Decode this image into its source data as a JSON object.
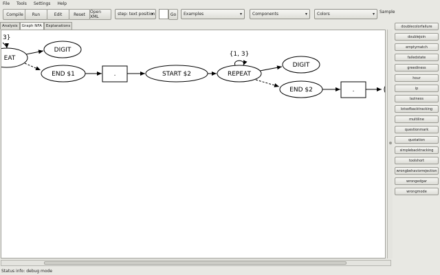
{
  "menu": [
    "File",
    "Tools",
    "Settings",
    "Help"
  ],
  "toolbar": {
    "compile": "Compile",
    "run": "Run",
    "edit": "Edit",
    "reset": "Reset",
    "open_xml": "Open XML",
    "position_field": "step: text position",
    "go": "Go",
    "examples": "Examples",
    "components": "Components",
    "colors": "Colors",
    "sample_label": "Sample"
  },
  "tabs": [
    "Analysis",
    "Graph NFA",
    "Explanations"
  ],
  "graph": {
    "nodes": {
      "repeat_left": "EAT",
      "repeat_left_range": "3}",
      "digit1": "DIGIT",
      "end1": "END $1",
      "dot1": ".",
      "start2": "START $2",
      "repeat2": "REPEAT",
      "repeat2_range": "{1, 3}",
      "digit2": "DIGIT",
      "end2": "END $2",
      "dot2": "."
    }
  },
  "samples": [
    "doublecolorfailure",
    "doublejoin",
    "emptymatch",
    "failedstate",
    "greediness",
    "hour",
    "ip",
    "laziness",
    "lotsofbacktracking",
    "multiline",
    "questionmark",
    "quotation",
    "simplebacktracking",
    "toolshort",
    "wrongbehaviorrejection",
    "wrongedgar",
    "wrongmode"
  ],
  "status": "Status info: debug mode"
}
